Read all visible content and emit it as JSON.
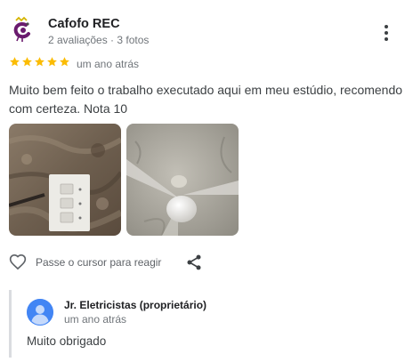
{
  "reviewer": {
    "name": "Cafofo REC",
    "meta": "2 avaliações · 3 fotos",
    "avatar_icon": "cafofo-logo-icon"
  },
  "rating": {
    "stars": 5,
    "max": 5,
    "color": "#fbbc04"
  },
  "review_date": "um ano atrás",
  "review_text": "Muito bem feito o trabalho executado aqui em meu estúdio, recomendo com certeza. Nota 10",
  "photos": [
    {
      "icon": "light-switch-photo"
    },
    {
      "icon": "ceiling-fan-photo"
    }
  ],
  "actions": {
    "like_hint": "Passe o cursor para reagir",
    "like_icon": "heart-outline-icon",
    "share_icon": "share-icon"
  },
  "owner_reply": {
    "name": "Jr. Eletricistas (proprietário)",
    "date": "um ano atrás",
    "text": "Muito obrigado",
    "avatar_color": "#4285f4"
  },
  "menu_icon": "more-vertical-icon"
}
